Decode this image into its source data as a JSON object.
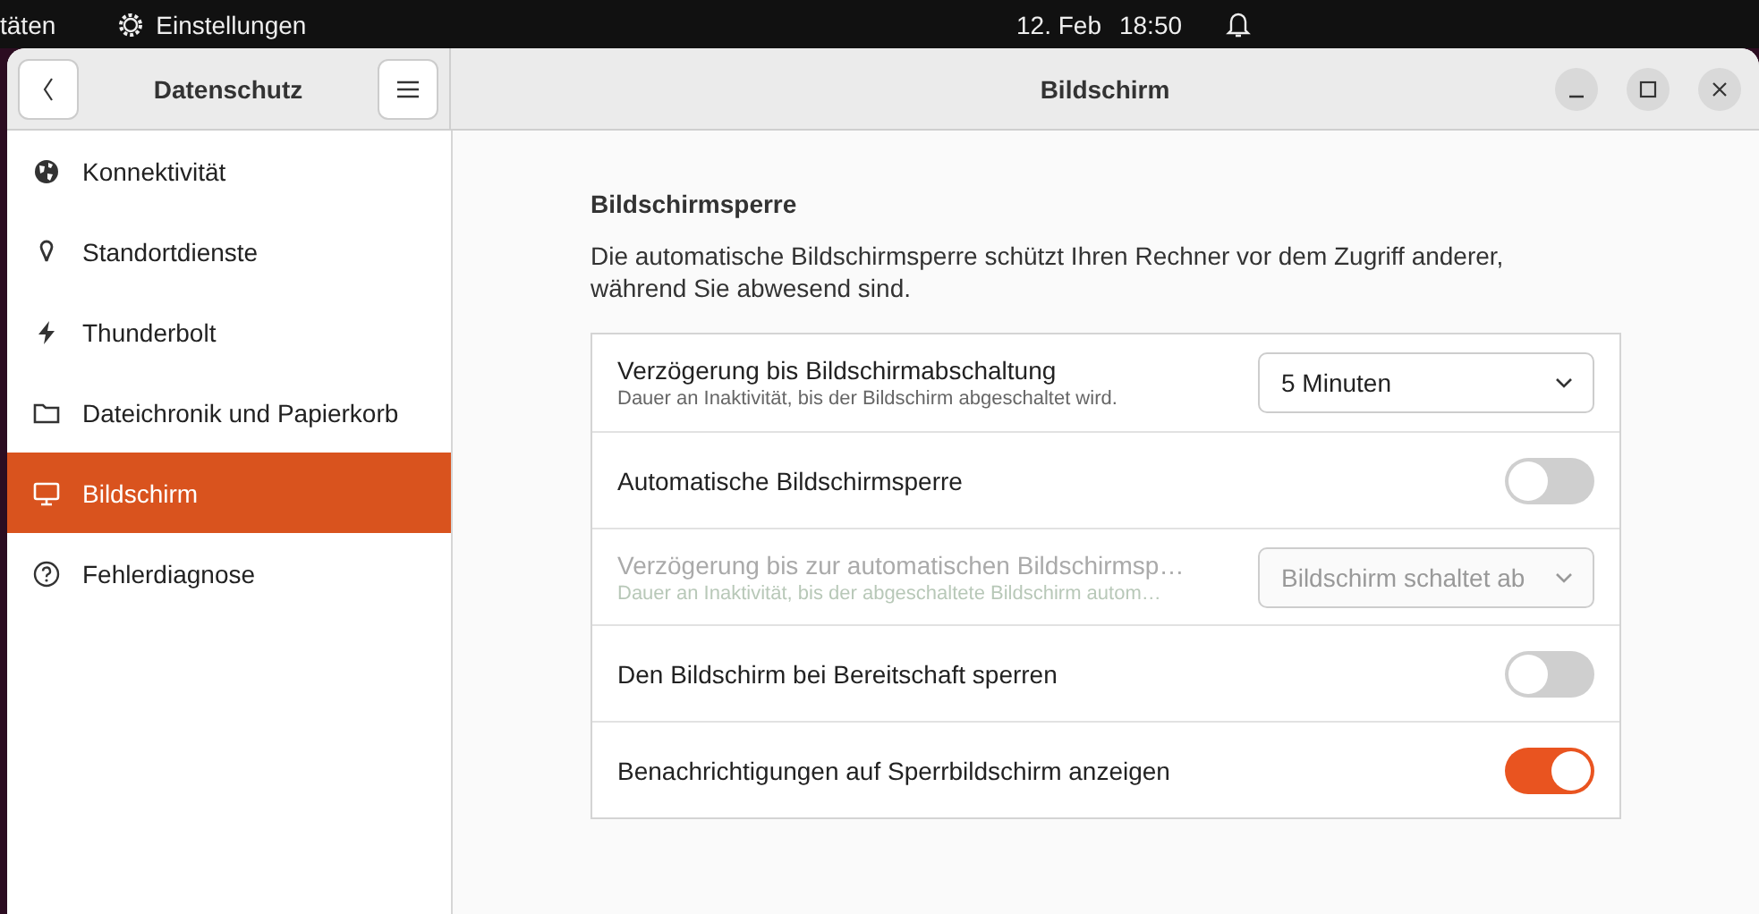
{
  "top_bar": {
    "activities": "täten",
    "app_name": "Einstellungen",
    "date": "12. Feb",
    "time": "18:50"
  },
  "sidebar": {
    "title": "Datenschutz",
    "items": [
      {
        "label": "Konnektivität",
        "selected": false
      },
      {
        "label": "Standortdienste",
        "selected": false
      },
      {
        "label": "Thunderbolt",
        "selected": false
      },
      {
        "label": "Dateichronik und Papierkorb",
        "selected": false
      },
      {
        "label": "Bildschirm",
        "selected": true
      },
      {
        "label": "Fehlerdiagnose",
        "selected": false
      }
    ]
  },
  "window": {
    "title": "Bildschirm"
  },
  "section": {
    "title": "Bildschirmsperre",
    "description": "Die automatische Bildschirmsperre schützt Ihren Rechner vor dem Zugriff anderer, während Sie abwesend sind.",
    "rows": [
      {
        "kind": "dropdown",
        "title": "Verzögerung bis Bildschirmabschaltung",
        "subtitle": "Dauer an Inaktivität, bis der Bildschirm abgeschaltet wird.",
        "value": "5 Minuten",
        "disabled": false
      },
      {
        "kind": "switch",
        "title": "Automatische Bildschirmsperre",
        "on": false,
        "disabled": false
      },
      {
        "kind": "dropdown",
        "title": "Verzögerung bis zur automatischen Bildschirmsp…",
        "subtitle": "Dauer an Inaktivität, bis der abgeschaltete Bildschirm autom…",
        "value": "Bildschirm schaltet ab",
        "disabled": true
      },
      {
        "kind": "switch",
        "title": "Den Bildschirm bei Bereitschaft sperren",
        "on": false,
        "disabled": false
      },
      {
        "kind": "switch",
        "title": "Benachrichtigungen auf Sperrbildschirm anzeigen",
        "on": true,
        "disabled": false
      }
    ]
  }
}
